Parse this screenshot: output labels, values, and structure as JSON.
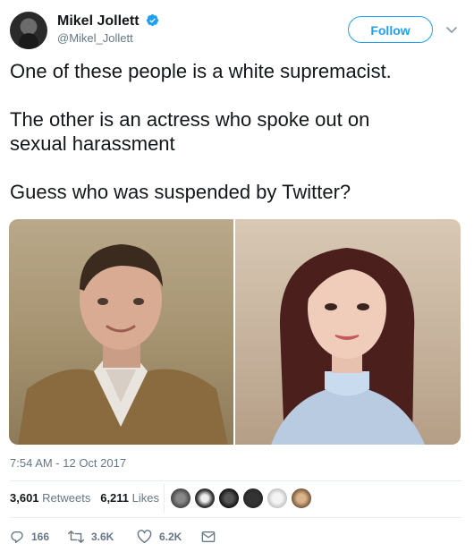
{
  "header": {
    "name": "Mikel Jollett",
    "handle": "@Mikel_Jollett",
    "follow_label": "Follow"
  },
  "tweet": {
    "line1": "One of these people is a white supremacist.",
    "line2": "The other is an actress who spoke out on\nsexual harassment",
    "line3": "Guess who was suspended by Twitter?"
  },
  "timestamp": "7:54 AM - 12 Oct 2017",
  "stats": {
    "retweets_count": "3,601",
    "retweets_label": "Retweets",
    "likes_count": "6,211",
    "likes_label": "Likes"
  },
  "actions": {
    "replies": "166",
    "retweets": "3.6K",
    "likes": "6.2K"
  },
  "colors": {
    "accent": "#1da1f2",
    "secondary_text": "#657786",
    "divider": "#e6ecf0"
  },
  "icons": [
    "verified-badge-icon",
    "chevron-down-icon",
    "reply-icon",
    "retweet-icon",
    "like-icon",
    "message-icon"
  ]
}
